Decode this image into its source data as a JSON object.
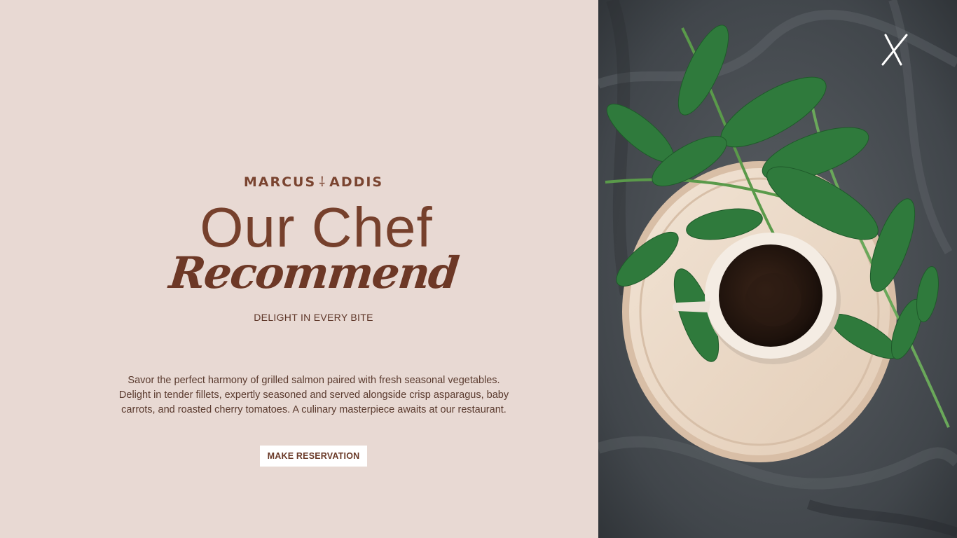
{
  "brand": {
    "left": "MARCUS",
    "mark": "⸸",
    "right": "ADDIS"
  },
  "hero": {
    "title_main": "Our Chef",
    "title_script": "Recommend",
    "tagline": "DELIGHT IN EVERY BITE",
    "description": "Savor the perfect harmony of grilled salmon paired with fresh seasonal vegetables. Delight in tender fillets, expertly seasoned and served alongside crisp asparagus, baby carrots, and roasted cherry tomatoes. A culinary masterpiece awaits at our restaurant.",
    "cta_label": "MAKE RESERVATION"
  },
  "colors": {
    "background": "#e8d9d3",
    "accent": "#76402c",
    "button_bg": "#ffffff"
  },
  "icons": {
    "close": "close-icon"
  }
}
